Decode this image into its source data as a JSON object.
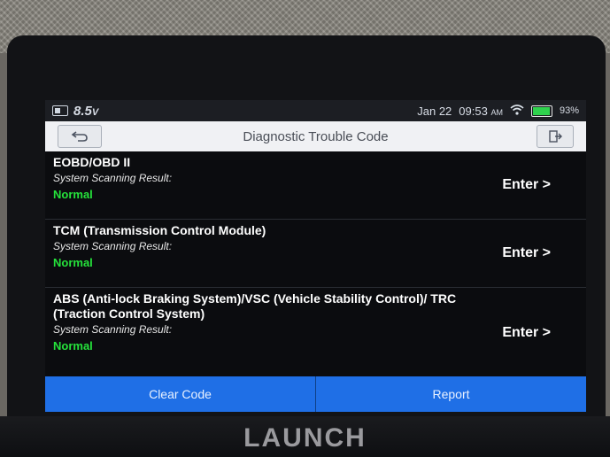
{
  "status": {
    "voltage": "8.5",
    "voltage_unit": "V",
    "date": "Jan 22",
    "time": "09:53",
    "time_suffix": "AM",
    "battery_percent": 93
  },
  "header": {
    "title": "Diagnostic Trouble Code",
    "back_icon": "back-arrow-icon",
    "exit_icon": "exit-icon"
  },
  "systems": [
    {
      "name": "EOBD/OBD II",
      "result_label": "System Scanning Result:",
      "status": "Normal",
      "enter_label": "Enter >"
    },
    {
      "name": "TCM (Transmission Control Module)",
      "result_label": "System Scanning Result:",
      "status": "Normal",
      "enter_label": "Enter >"
    },
    {
      "name": "ABS (Anti-lock Braking System)/VSC (Vehicle Stability Control)/ TRC (Traction Control System)",
      "result_label": "System Scanning Result:",
      "status": "Normal",
      "enter_label": "Enter >"
    }
  ],
  "buttons": {
    "clear_code": "Clear Code",
    "report": "Report"
  },
  "device": {
    "brand": "LAUNCH"
  },
  "colors": {
    "accent": "#1f6fe6",
    "status_normal": "#25e23b",
    "battery": "#2fd14d"
  }
}
